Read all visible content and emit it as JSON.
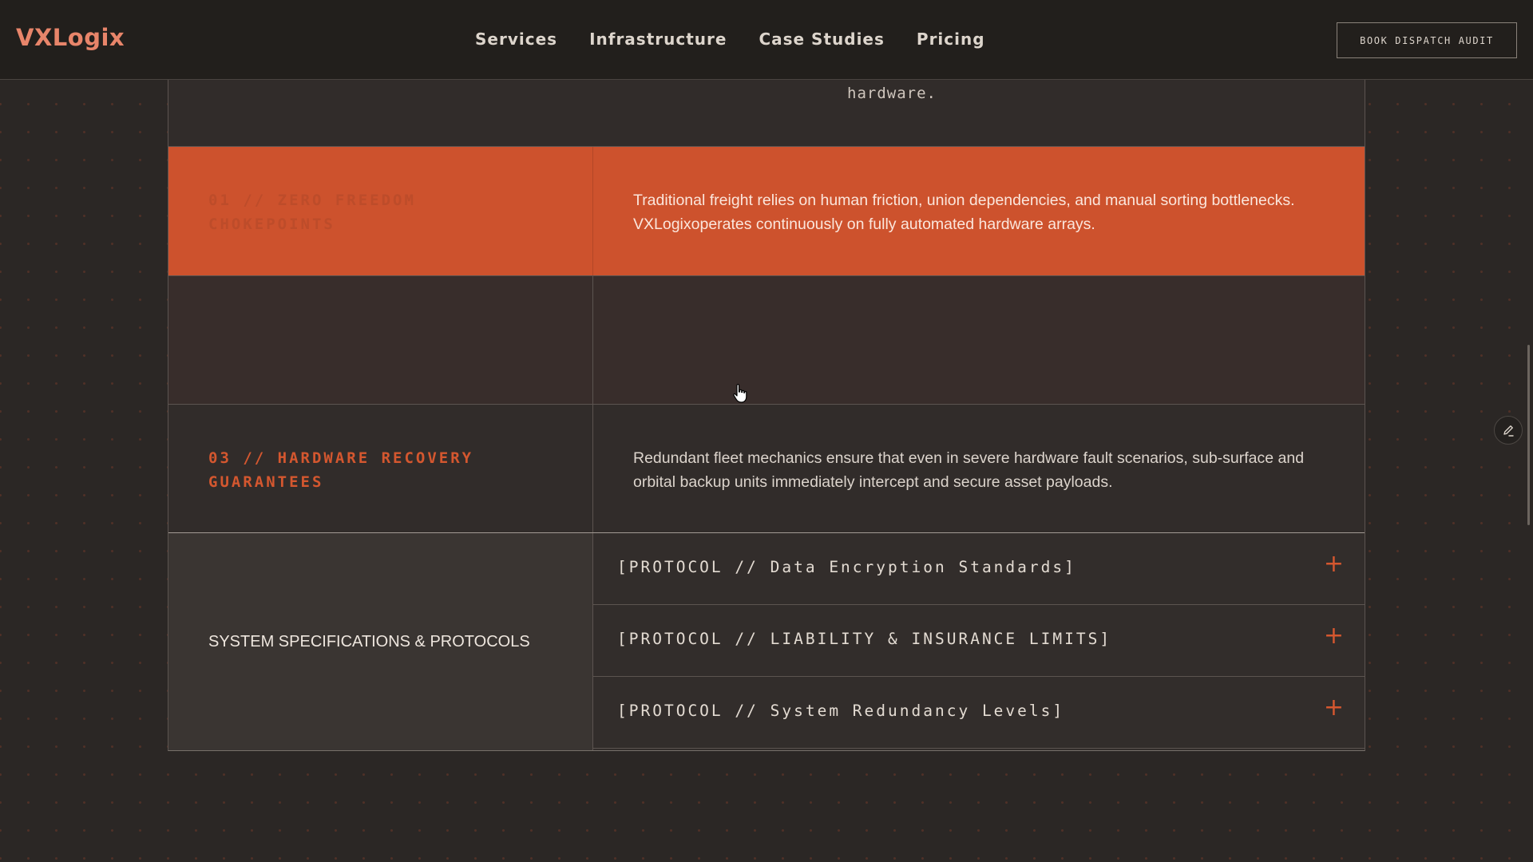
{
  "nav": {
    "logo": "VXLogix",
    "links": [
      "Services",
      "Infrastructure",
      "Case Studies",
      "Pricing"
    ],
    "cta": "BOOK DISPATCH AUDIT"
  },
  "top_fragment": {
    "text": "hardware."
  },
  "features": [
    {
      "title": "01 // ZERO FREEDOM CHOKEPOINTS",
      "description": "Traditional freight relies on human friction, union dependencies, and manual sorting bottlenecks. VXLogixoperates continuously on fully automated hardware arrays."
    },
    {
      "title": "",
      "description": ""
    },
    {
      "title": "03 // HARDWARE RECOVERY GUARANTEES",
      "description": "Redundant fleet mechanics ensure that even in severe hardware fault scenarios, sub-surface and orbital  backup units immediately intercept and secure asset payloads."
    }
  ],
  "specs": {
    "title": "SYSTEM SPECIFICATIONS & PROTOCOLS",
    "protocols": [
      "[PROTOCOL // Data Encryption Standards]",
      "[PROTOCOL // LIABILITY & INSURANCE LIMITS]",
      "[PROTOCOL // System Redundancy Levels]"
    ],
    "expand_glyph": "+"
  },
  "icons": {
    "edit": "pencil-icon",
    "cursor": "hand-pointer-cursor-icon"
  },
  "colors": {
    "accent": "#cd522d",
    "background": "#2b2725",
    "nav_background": "#221f1c"
  }
}
